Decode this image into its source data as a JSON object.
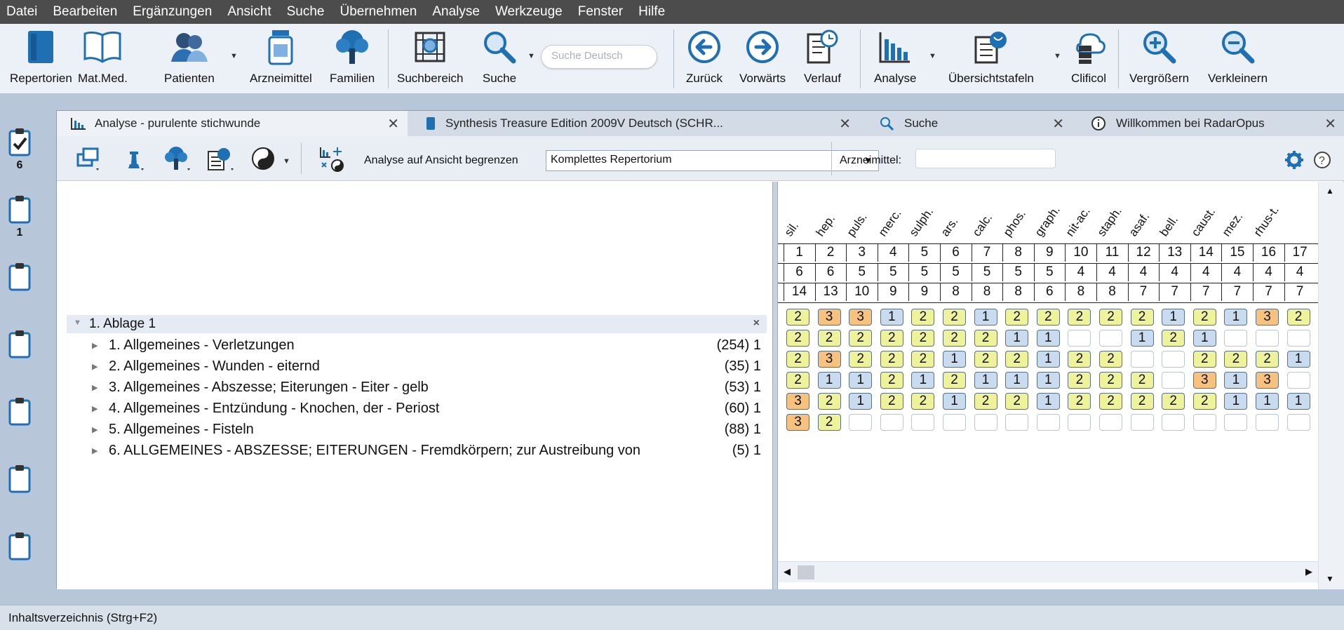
{
  "menu": [
    "Datei",
    "Bearbeiten",
    "Ergänzungen",
    "Ansicht",
    "Suche",
    "Übernehmen",
    "Analyse",
    "Werkzeuge",
    "Fenster",
    "Hilfe"
  ],
  "toolbar": {
    "repertorien": "Repertorien",
    "matmed": "Mat.Med.",
    "patienten": "Patienten",
    "arzneimittel": "Arzneimittel",
    "familien": "Familien",
    "suchbereich": "Suchbereich",
    "suche": "Suche",
    "search_placeholder": "Suche Deutsch",
    "zurueck": "Zurück",
    "vorwaerts": "Vorwärts",
    "verlauf": "Verlauf",
    "analyse": "Analyse",
    "uebersicht": "Übersichtstafeln",
    "clificol": "Clificol",
    "vergroessern": "Vergrößern",
    "verkleinern": "Verkleinern"
  },
  "sidebar_counts": [
    "6",
    "1"
  ],
  "tabs": [
    "Analyse - purulente stichwunde",
    "Synthesis Treasure Edition 2009V Deutsch (SCHR...",
    "Suche",
    "Willkommen bei RadarOpus"
  ],
  "analysis_toolbar": {
    "limit_label": "Analyse auf Ansicht begrenzen",
    "limit_value": "Komplettes Repertorium",
    "remedy_label": "Arzneimittel:"
  },
  "group": {
    "title": "1. Ablage 1",
    "close": "×"
  },
  "rubrics": [
    {
      "text": "1. Allgemeines - Verletzungen",
      "count": "(254) 1"
    },
    {
      "text": "2. Allgemeines - Wunden - eiternd",
      "count": "(35) 1"
    },
    {
      "text": "3. Allgemeines - Abszesse; Eiterungen - Eiter - gelb",
      "count": "(53) 1"
    },
    {
      "text": "4. Allgemeines - Entzündung - Knochen, der - Periost",
      "count": "(60) 1"
    },
    {
      "text": "5. Allgemeines - Fisteln",
      "count": "(88) 1"
    },
    {
      "text": "6. ALLGEMEINES - ABSZESSE; EITERUNGEN - Fremdkörpern; zur Austreibung von",
      "count": "(5) 1"
    }
  ],
  "remedies": [
    "sil.",
    "hep.",
    "puls.",
    "merc.",
    "sulph.",
    "ars.",
    "calc.",
    "phos.",
    "graph.",
    "nit-ac.",
    "staph.",
    "asaf.",
    "bell.",
    "caust.",
    "mez.",
    "rhus-t.",
    ""
  ],
  "header_rows": {
    "rank": [
      "1",
      "2",
      "3",
      "4",
      "5",
      "6",
      "7",
      "8",
      "9",
      "10",
      "11",
      "12",
      "13",
      "14",
      "15",
      "16",
      "17"
    ],
    "hits": [
      "6",
      "6",
      "5",
      "5",
      "5",
      "5",
      "5",
      "5",
      "5",
      "4",
      "4",
      "4",
      "4",
      "4",
      "4",
      "4",
      "4"
    ],
    "degrees": [
      "14",
      "13",
      "10",
      "9",
      "9",
      "8",
      "8",
      "8",
      "6",
      "8",
      "8",
      "7",
      "7",
      "7",
      "7",
      "7",
      "7"
    ]
  },
  "grades": [
    [
      "2",
      "3",
      "3",
      "1",
      "2",
      "2",
      "1",
      "2",
      "2",
      "2",
      "2",
      "2",
      "1",
      "2",
      "1",
      "3",
      "2"
    ],
    [
      "2",
      "2",
      "2",
      "2",
      "2",
      "2",
      "2",
      "1",
      "1",
      "",
      "",
      "1",
      "2",
      "1",
      "",
      "",
      ""
    ],
    [
      "2",
      "3",
      "2",
      "2",
      "2",
      "1",
      "2",
      "2",
      "1",
      "2",
      "2",
      "",
      "",
      "2",
      "2",
      "2",
      "1"
    ],
    [
      "2",
      "1",
      "1",
      "2",
      "1",
      "2",
      "1",
      "1",
      "1",
      "2",
      "2",
      "2",
      "",
      "3",
      "1",
      "3",
      ""
    ],
    [
      "3",
      "2",
      "1",
      "2",
      "2",
      "1",
      "2",
      "2",
      "1",
      "2",
      "2",
      "2",
      "2",
      "2",
      "1",
      "1",
      "1"
    ],
    [
      "3",
      "2",
      "",
      "",
      "",
      "",
      "",
      "",
      "",
      "",
      "",
      "",
      "",
      "",
      "",
      "",
      ""
    ]
  ],
  "status": "Inhaltsverzeichnis (Strg+F2)"
}
